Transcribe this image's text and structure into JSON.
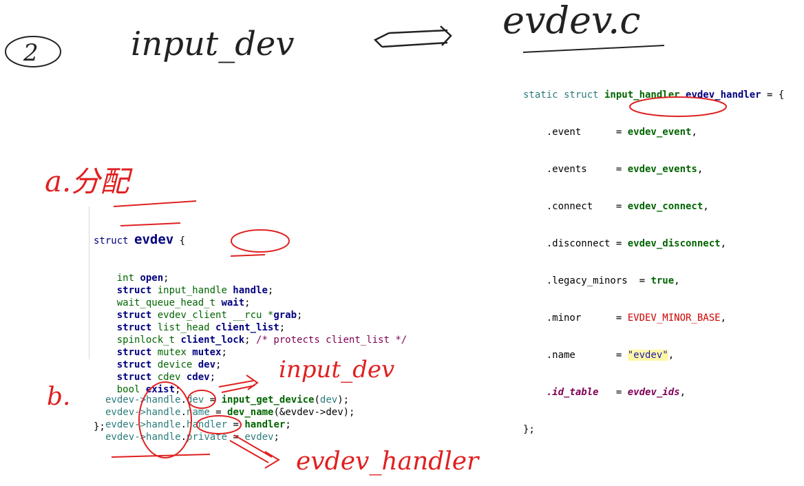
{
  "handwriting": {
    "step_number": "2",
    "title_left": "input_dev",
    "arrow": "<=>",
    "title_right": "evdev.c",
    "label_a": "a.分配",
    "label_b": "b.",
    "note_input_dev": "input_dev",
    "note_evdev_handler": "evdev_handler"
  },
  "handler_code": {
    "l1": {
      "kw1": "static struct",
      "ty": " input_handler",
      "name": " evdev_handler",
      "rest": " = {"
    },
    "l2": {
      "field": "    .event      = ",
      "val": "evdev_event",
      "end": ","
    },
    "l3": {
      "field": "    .events     = ",
      "val": "evdev_events",
      "end": ","
    },
    "l4": {
      "field": "    .connect    = ",
      "val": "evdev_connect",
      "end": ","
    },
    "l5": {
      "field": "    .disconnect = ",
      "val": "evdev_disconnect",
      "end": ","
    },
    "l6": {
      "field": "    .legacy_minors  = ",
      "val": "true",
      "end": ","
    },
    "l7": {
      "field": "    .minor      = ",
      "val": "EVDEV_MINOR_BASE",
      "end": ","
    },
    "l8": {
      "field": "    .name       = ",
      "val": "\"evdev\"",
      "end": ","
    },
    "l9": {
      "field": "    .id_table",
      "mid": "   = ",
      "val": "evdev_ids",
      "end": ","
    },
    "l10": "};"
  },
  "struct_code": {
    "head": {
      "kw": "struct",
      "name": "evdev",
      "rest": " {"
    },
    "lines": [
      {
        "ty": "    int",
        "fld": " open",
        "end": ";"
      },
      {
        "ty": "    struct input_handle",
        "fld": " handle",
        "end": ";"
      },
      {
        "ty": "    wait_queue_head_t",
        "fld": " wait",
        "end": ";"
      },
      {
        "ty": "    struct evdev_client __rcu *",
        "fld": "grab",
        "end": ";"
      },
      {
        "ty": "    struct list_head",
        "fld": " client_list",
        "end": ";"
      },
      {
        "ty": "    spinlock_t",
        "fld": " client_lock",
        "end": "; ",
        "cmt": "/* protects client_list */"
      },
      {
        "ty": "    struct mutex",
        "fld": " mutex",
        "end": ";"
      },
      {
        "ty": "    struct device",
        "fld": " dev",
        "end": ";"
      },
      {
        "ty": "    struct cdev",
        "fld": " cdev",
        "end": ";"
      },
      {
        "ty": "    bool",
        "fld": " exist",
        "end": ";"
      }
    ],
    "close": "};"
  },
  "assign_code": [
    {
      "a": "evdev->",
      "b": "handle",
      "c": ".",
      "d": "dev",
      "e": " = ",
      "f": "input_get_device",
      "g": "(",
      "h": "dev",
      "i": ");"
    },
    {
      "a": "evdev->",
      "b": "handle",
      "c": ".",
      "d": "name",
      "e": " = ",
      "f": "dev_name",
      "g": "(&evdev->dev);",
      "h": "",
      "i": ""
    },
    {
      "a": "evdev->",
      "b": "handle",
      "c": ".",
      "d": "handler",
      "e": " = ",
      "f": "handler",
      "g": ";",
      "h": "",
      "i": ""
    },
    {
      "a": "evdev->",
      "b": "handle",
      "c": ".",
      "d": "private",
      "e": " = ",
      "f": "evdev",
      "g": ";",
      "h": "",
      "i": ""
    }
  ]
}
